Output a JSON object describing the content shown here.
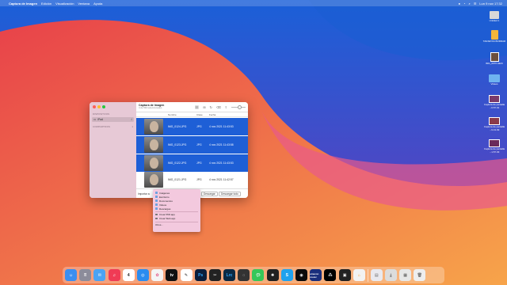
{
  "menubar": {
    "apple": "",
    "app": "Captura de Imagen",
    "items": [
      "Edición",
      "Visualización",
      "Ventana",
      "Ayuda"
    ],
    "datetime": "Lun 9 nov  17:32"
  },
  "desktop": {
    "icons": [
      {
        "label": "Untitled 1"
      },
      {
        "label": "TARJETAS BORRAR"
      },
      {
        "label": "IMG_0070.HEIC"
      },
      {
        "label": "Videos"
      },
      {
        "label": "Captura de pantalla ...6.57.01"
      },
      {
        "label": "Captura de pantalla ...9.13.09"
      },
      {
        "label": "Captura de pantalla ...1.57.03"
      }
    ]
  },
  "window": {
    "sidebar": {
      "devices_header": "DISPOSITIVOS",
      "device": {
        "name": "iPad",
        "count": "4"
      },
      "shared_header": "COMPARTIDOS",
      "shared_count": "1"
    },
    "toolbar": {
      "title": "Captura de Imagen",
      "subtitle": "4 de 594 seleccionados"
    },
    "columns": [
      "Nombre",
      "Clase",
      "Fecha"
    ],
    "rows": [
      {
        "name": "IMG_0124.JPG",
        "kind": "JPG",
        "date": "4 nov 2021 11:43:53",
        "selected": true
      },
      {
        "name": "IMG_0123.JPG",
        "kind": "JPG",
        "date": "4 nov 2021 11:43:58",
        "selected": true
      },
      {
        "name": "IMG_0122.JPG",
        "kind": "JPG",
        "date": "4 nov 2021 11:43:53",
        "selected": true
      },
      {
        "name": "IMG_0121.JPG",
        "kind": "JPG",
        "date": "4 nov 2021 11:42:57",
        "selected": false
      }
    ],
    "bottom": {
      "import_label": "Importar a:",
      "download_label": "Descargar",
      "download_all_label": "Descargar todo"
    }
  },
  "menu": {
    "items": [
      "Imágenes",
      "Escritorio",
      "Documentos",
      "Videos",
      "Descargas"
    ],
    "apps": [
      "Crear PDF.app",
      "Crear Web.app"
    ],
    "other": "Otros..."
  },
  "dock": {
    "apps": [
      {
        "name": "Finder",
        "color": "#3b8ef0"
      },
      {
        "name": "Launchpad",
        "color": "#8c8c9a"
      },
      {
        "name": "Mail",
        "color": "#4aa3f3"
      },
      {
        "name": "Music",
        "color": "#f03b55"
      },
      {
        "name": "Calendar",
        "color": "#ffffff"
      },
      {
        "name": "Safari",
        "color": "#2a8cf0"
      },
      {
        "name": "Photos",
        "color": "#f4f4f4"
      },
      {
        "name": "Apple TV",
        "color": "#111111"
      },
      {
        "name": "Vectornator",
        "color": "#ffffff"
      },
      {
        "name": "Photoshop",
        "color": "#0b1e3c"
      },
      {
        "name": "Final Cut Pro",
        "color": "#222222"
      },
      {
        "name": "Lightroom Classic",
        "color": "#0b2a44"
      },
      {
        "name": "Motion",
        "color": "#333333"
      },
      {
        "name": "Messages",
        "color": "#35c759"
      },
      {
        "name": "ChatGPT",
        "color": "#202020"
      },
      {
        "name": "Skype",
        "color": "#1fa2ee"
      },
      {
        "name": "Quik",
        "color": "#0a0a0a"
      },
      {
        "name": "Amazon Music",
        "color": "#1a2e7c"
      },
      {
        "name": "Tidal",
        "color": "#000000"
      },
      {
        "name": "Capture One",
        "color": "#222222"
      },
      {
        "name": "Home",
        "color": "#f2f2f2"
      },
      {
        "name": "Preview",
        "color": "#e9e9ef"
      },
      {
        "name": "Downloads",
        "color": "#dcdcdc"
      },
      {
        "name": "Image Capture",
        "color": "#e7e7e7"
      },
      {
        "name": "Trash",
        "color": "#eeeeee"
      }
    ],
    "calendar_day": "4",
    "amazon_label": "amazon music",
    "lrc_label": "Lrc",
    "ps_label": "Ps",
    "s_label": "S"
  }
}
